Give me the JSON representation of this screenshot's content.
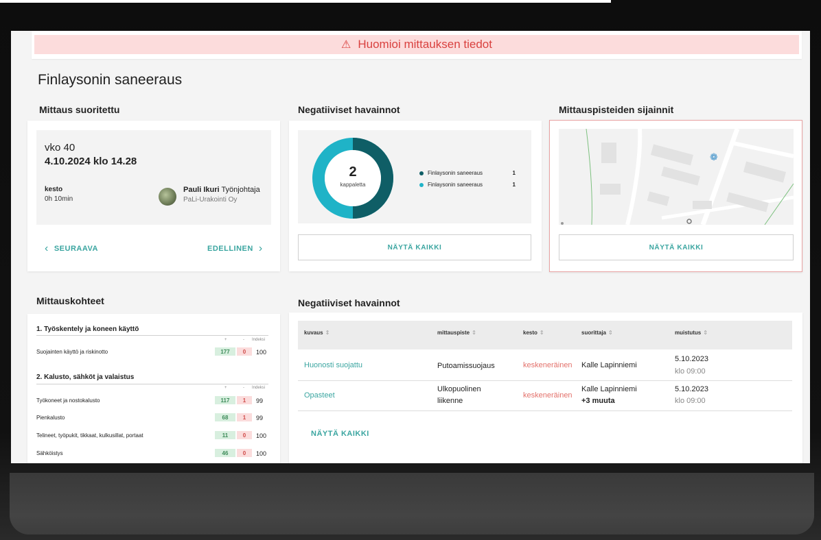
{
  "alert": {
    "icon": "warning-icon",
    "text": "Huomioi mittauksen tiedot"
  },
  "page_title": "Finlaysonin saneeraus",
  "sections": {
    "mittaus": "Mittaus suoritettu",
    "negatiiviset": "Negatiiviset havainnot",
    "sijainnit": "Mittauspisteiden sijainnit",
    "kohteet": "Mittauskohteet",
    "negatiiviset_table": "Negatiiviset havainnot"
  },
  "measurement": {
    "week": "vko 40",
    "datetime": "4.10.2024 klo 14.28",
    "duration_label": "kesto",
    "duration_value": "0h 10min",
    "person_name": "Pauli Ikuri",
    "person_role": "Työnjohtaja",
    "company": "PaLi-Urakointi Oy",
    "prev_label": "SEURAAVA",
    "next_label": "EDELLINEN"
  },
  "donut": {
    "count": "2",
    "unit": "kappaletta",
    "legend": [
      {
        "name": "Finlaysonin saneeraus",
        "count": "1",
        "color": "#0f5e66"
      },
      {
        "name": "Finlaysonin saneeraus",
        "count": "1",
        "color": "#1fb3c7"
      }
    ],
    "button": "NÄYTÄ KAIKKI"
  },
  "map": {
    "button": "NÄYTÄ KAIKKI",
    "marker_icon": "location-cluster-icon",
    "accent": "#e8a2a2"
  },
  "kohteet": {
    "col_plus": "+",
    "col_minus": "-",
    "col_index": "Indeksi",
    "groups": [
      {
        "title": "1. Työskentely ja koneen käyttö",
        "rows": [
          {
            "name": "Suojainten käyttö ja riskinotto",
            "plus": "177",
            "minus": "0",
            "index": "100"
          }
        ]
      },
      {
        "title": "2. Kalusto, sähköt ja valaistus",
        "rows": [
          {
            "name": "Työkoneet ja nostokalusto",
            "plus": "117",
            "minus": "1",
            "index": "99"
          },
          {
            "name": "Pienkalusto",
            "plus": "68",
            "minus": "1",
            "index": "99"
          },
          {
            "name": "Telineet, työpukit, tikkaat, kulkusillat, portaat",
            "plus": "11",
            "minus": "0",
            "index": "100"
          },
          {
            "name": "Sähköistys",
            "plus": "46",
            "minus": "0",
            "index": "100"
          }
        ]
      }
    ]
  },
  "table": {
    "headers": [
      "kuvaus",
      "mittauspiste",
      "kesto",
      "suorittaja",
      "muistutus"
    ],
    "rows": [
      {
        "kuvaus": "Huonosti suojattu",
        "mittauspiste_1": "Putoamissuojaus",
        "mittauspiste_2": "",
        "kesto": "keskeneräinen",
        "suorittaja_1": "Kalle Lapinniemi",
        "suorittaja_2": "",
        "muistutus_date": "5.10.2023",
        "muistutus_time": "klo 09:00"
      },
      {
        "kuvaus": "Opasteet",
        "mittauspiste_1": "Ulkopuolinen",
        "mittauspiste_2": "liikenne",
        "kesto": "keskeneräinen",
        "suorittaja_1": "Kalle Lapinniemi",
        "suorittaja_2": "+3 muuta",
        "muistutus_date": "5.10.2023",
        "muistutus_time": "klo 09:00"
      }
    ],
    "show_all": "NÄYTÄ KAIKKI"
  },
  "colors": {
    "teal": "#3aa5a0",
    "alert_bg": "#fcdcdc",
    "alert_text": "#d9413f"
  }
}
